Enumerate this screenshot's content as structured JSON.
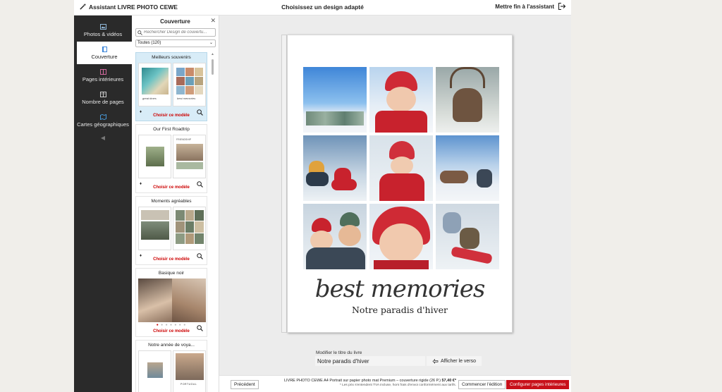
{
  "topbar": {
    "brand": "Assistant LIVRE PHOTO CEWE",
    "title": "Choisissez un design adapté",
    "exit_label": "Mettre fin à l'assistant"
  },
  "nav": {
    "items": [
      {
        "label": "Photos & vidéos",
        "icon": "photo-icon"
      },
      {
        "label": "Couverture",
        "icon": "cover-icon"
      },
      {
        "label": "Pages intérieures",
        "icon": "pages-icon"
      },
      {
        "label": "Nombre de pages",
        "icon": "page-count-icon"
      },
      {
        "label": "Cartes géographiques",
        "icon": "map-icon"
      }
    ],
    "active": "Couverture"
  },
  "panel": {
    "title": "Couverture",
    "search_placeholder": "Rechercher Design de couvertu...",
    "filter_value": "Toutes (120)",
    "cards": [
      {
        "title": "Meilleurs souvenirs",
        "cta": "Choisir ce modèle"
      },
      {
        "title": "Our First Roadtrip",
        "cta": "Choisir ce modèle"
      },
      {
        "title": "Moments agréables",
        "cta": "Choisir ce modèle"
      },
      {
        "title": "Basique noir",
        "cta": "Choisir ce modèle"
      },
      {
        "title": "Notre année de voya..."
      }
    ],
    "thumb_texts": {
      "card1_left": "great times",
      "card1_right": "best memories",
      "card2_right": "FRIENDSHIP",
      "card5_right": "PORTUGAL"
    }
  },
  "cover": {
    "title": "best memories",
    "subtitle": "Notre paradis d'hiver"
  },
  "editor": {
    "title_label": "Modifier le titre du livre",
    "title_value": "Notre paradis d'hiver",
    "verso_label": "Afficher le verso"
  },
  "footer": {
    "prev_label": "Précédent",
    "product": "LIVRE PHOTO CEWE A4 Portrait sur papier photo mat Premium – couverture rigide (26 P.)",
    "price": "57,40 €*",
    "note": "* Les prix s'entendent TVA incluse, hors frais d'envoi conformément aux tarifs.",
    "edit_label": "Commencer l'édition",
    "next_label": "Configurer pages intérieures"
  },
  "colors": {
    "accent_red": "#c8101a",
    "nav_bg": "#2a2a2a",
    "canvas_bg": "#ececec"
  }
}
